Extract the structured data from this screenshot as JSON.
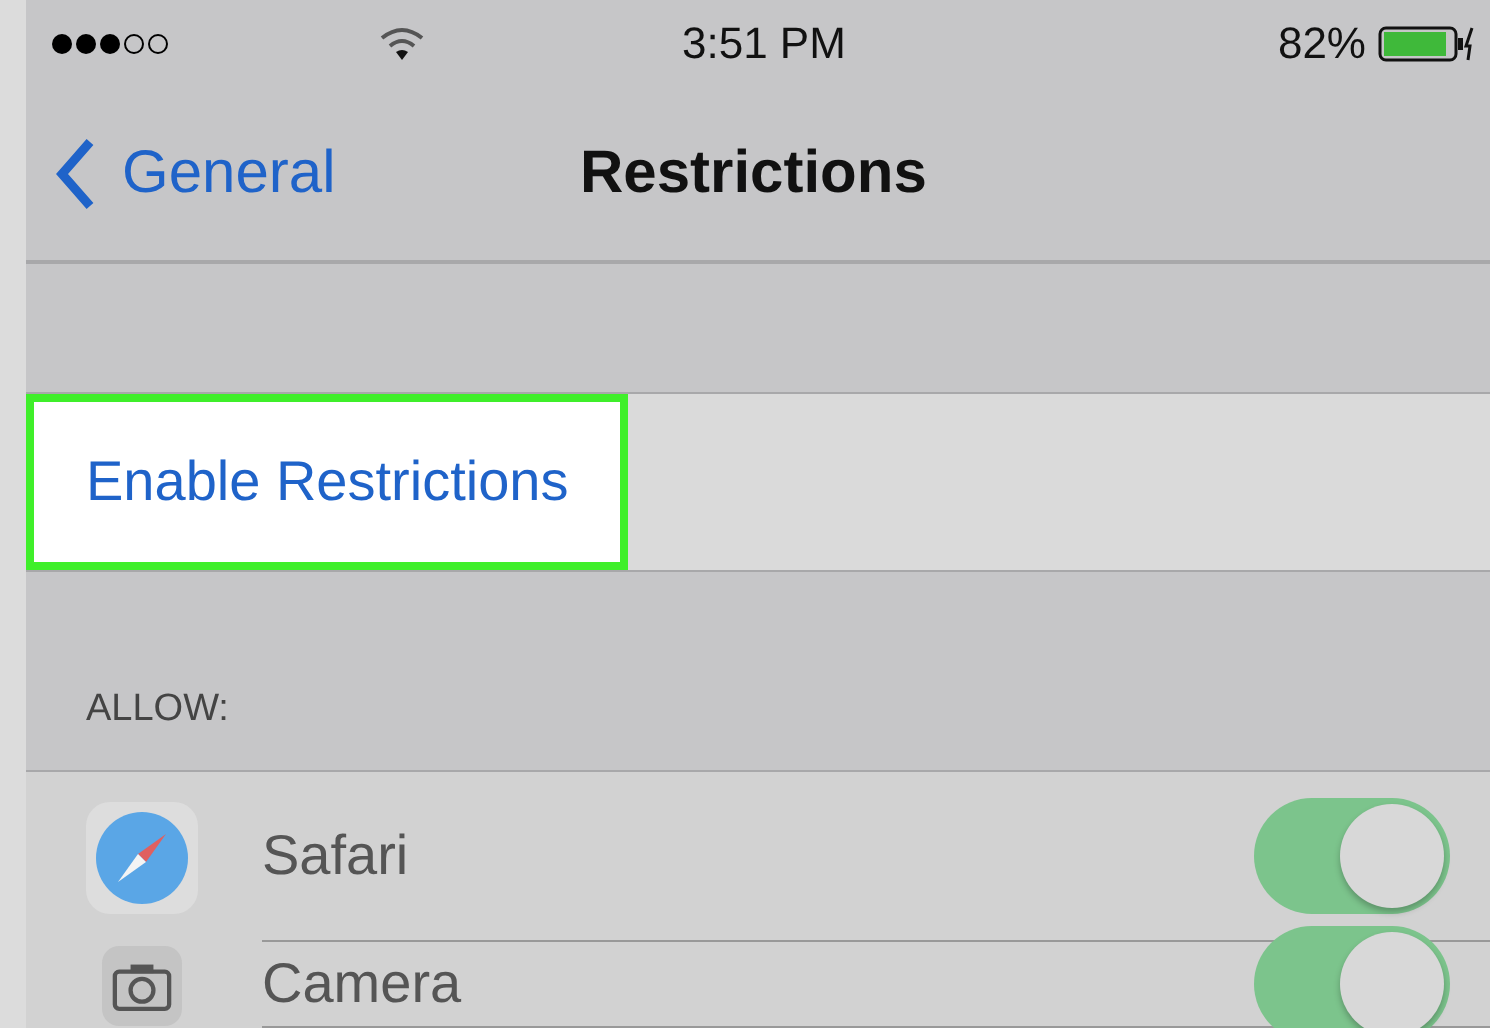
{
  "status_bar": {
    "time": "3:51 PM",
    "battery": "82%"
  },
  "nav": {
    "back": "General",
    "title": "Restrictions"
  },
  "enable_row": {
    "label": "Enable Restrictions",
    "highlighted": true
  },
  "section_header": "ALLOW:",
  "rows": [
    {
      "label": "Safari",
      "on": true
    },
    {
      "label": "Camera",
      "on": true
    }
  ]
}
